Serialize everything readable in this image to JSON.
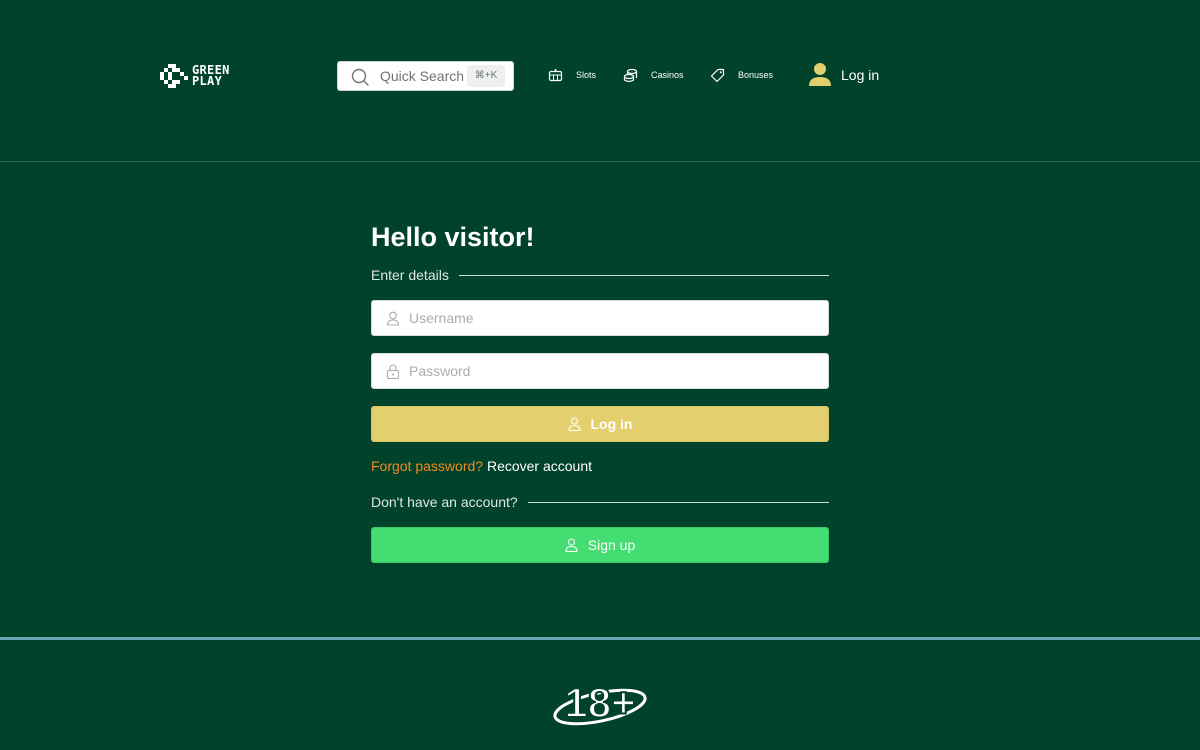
{
  "header": {
    "logo": {
      "line1": "GREEN",
      "line2": "PLAY"
    },
    "search": {
      "placeholder": "Quick Search",
      "shortcut": "⌘+K"
    },
    "nav": [
      {
        "label": "Slots",
        "icon": "slot-machine-icon"
      },
      {
        "label": "Casinos",
        "icon": "coins-icon"
      },
      {
        "label": "Bonuses",
        "icon": "tag-icon"
      }
    ],
    "login_label": "Log in"
  },
  "form": {
    "title": "Hello visitor!",
    "details_label": "Enter details",
    "username_placeholder": "Username",
    "password_placeholder": "Password",
    "login_button": "Log in",
    "forgot_question": "Forgot password?",
    "recover_link": "Recover account",
    "no_account_label": "Don't have an account?",
    "signup_button": "Sign up"
  },
  "footer": {
    "age_badge": "18+"
  },
  "colors": {
    "background": "#01422a",
    "login_button": "#e3cf6e",
    "signup_button": "#43dd72",
    "forgot_text": "#f08a24",
    "footer_line": "#6aa4b4"
  }
}
